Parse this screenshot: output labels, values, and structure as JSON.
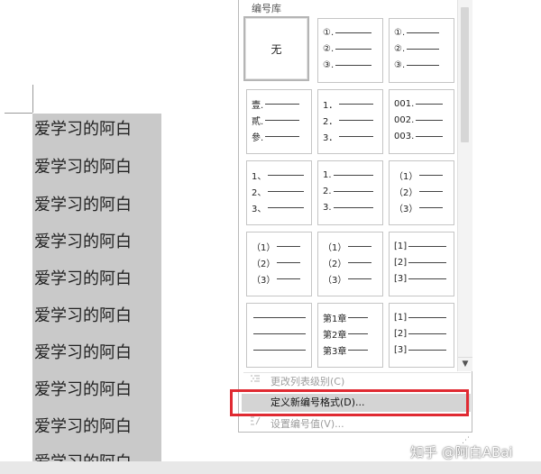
{
  "document": {
    "lines": [
      "爱学习的阿白",
      "爱学习的阿白",
      "爱学习的阿白",
      "爱学习的阿白",
      "爱学习的阿白",
      "爱学习的阿白",
      "爱学习的阿白",
      "爱学习的阿白",
      "爱学习的阿白",
      "爱学习的阿白"
    ]
  },
  "panel": {
    "title": "编号库",
    "none_label": "无",
    "cells": [
      [
        "①.",
        "②.",
        "③."
      ],
      [
        "①.",
        "②.",
        "③."
      ],
      [
        "壹.",
        "貳.",
        "參."
      ],
      [
        "1．",
        "2．",
        "3．"
      ],
      [
        "001.",
        "002.",
        "003."
      ],
      [
        "1、",
        "2、",
        "3、"
      ],
      [
        "1.",
        "2.",
        "3."
      ],
      [
        "（1）",
        "（2）",
        "（3）"
      ],
      [
        "（1）",
        "（2）",
        "（3）"
      ],
      [
        "（1）",
        "（2）",
        "（3）"
      ],
      [
        "[1]",
        "[2]",
        "[3]"
      ],
      [
        "",
        "",
        ""
      ],
      [
        "第1章",
        "第2章",
        "第3章"
      ],
      [
        "[1]",
        "[2]",
        "[3]"
      ]
    ]
  },
  "menu": {
    "change_level": "更改列表级别(C)",
    "define_new": "定义新编号格式(D)...",
    "set_value": "设置编号值(V)..."
  },
  "watermark": "知乎 @阿白ABai",
  "icons": {
    "scroll_down": "▼"
  }
}
